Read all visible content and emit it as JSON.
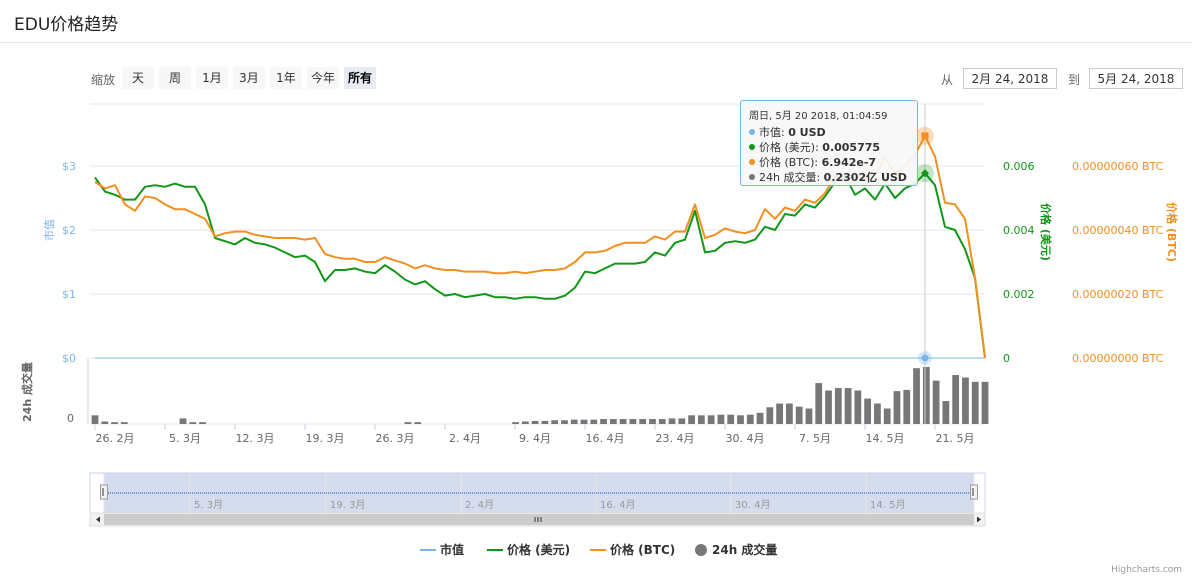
{
  "header": {
    "title": "EDU价格趋势"
  },
  "toolbar": {
    "zoom_label": "缩放",
    "zoom_buttons": [
      "天",
      "周",
      "1月",
      "3月",
      "1年",
      "今年",
      "所有"
    ],
    "from_label": "从",
    "to_label": "到",
    "from_date": "2月 24, 2018",
    "to_date": "5月 24, 2018"
  },
  "tooltip": {
    "date": "周日, 5月 20 2018, 01:04:59",
    "rows": [
      {
        "label": "市值: ",
        "value": "0 USD",
        "color": "#7cb5ec"
      },
      {
        "label": "价格 (美元): ",
        "value": "0.005775",
        "color": "#109618"
      },
      {
        "label": "价格 (BTC): ",
        "value": "6.942e-7",
        "color": "#f28f1e"
      },
      {
        "label": "24h 成交量: ",
        "value": "0.2302亿 USD",
        "color": "#777777"
      }
    ]
  },
  "navigator": {
    "labels": [
      "5. 3月",
      "19. 3月",
      "2. 4月",
      "16. 4月",
      "30. 4月",
      "14. 5月"
    ]
  },
  "credit": "Highcharts.com",
  "chart_data": {
    "type": "line",
    "title": "EDU价格趋势",
    "x_tick_labels": [
      "26. 2月",
      "5. 3月",
      "12. 3月",
      "19. 3月",
      "26. 3月",
      "2. 4月",
      "9. 4月",
      "16. 4月",
      "23. 4月",
      "30. 4月",
      "7. 5月",
      "14. 5月",
      "21. 5月"
    ],
    "y_axes": {
      "market_cap": {
        "label": "市值",
        "ticks": [
          "$0",
          "$1",
          "$2",
          "$3"
        ],
        "range": [
          0,
          3
        ],
        "color": "#7cb5ec"
      },
      "price_usd": {
        "label": "价格 (美元)",
        "ticks": [
          "0",
          "0.002",
          "0.004",
          "0.006"
        ],
        "range": [
          0,
          0.006
        ],
        "color": "#109618"
      },
      "price_btc": {
        "label": "价格 (BTC)",
        "ticks": [
          "0.00000000 BTC",
          "0.00000020 BTC",
          "0.00000040 BTC",
          "0.00000060 BTC"
        ],
        "range": [
          0,
          6e-07
        ],
        "color": "#f28f1e"
      },
      "volume": {
        "label": "24h 成交量",
        "ticks": [
          "0"
        ],
        "color": "#777777"
      }
    },
    "legend": [
      "市值",
      "价格 (美元)",
      "价格 (BTC)",
      "24h 成交量"
    ],
    "legend_position": "bottom-center",
    "x_start_day": 0,
    "x_end_day": 89,
    "series": [
      {
        "name": "价格 (美元)",
        "color": "#109618",
        "axis": "price_usd",
        "points": [
          [
            0,
            0.00564
          ],
          [
            1,
            0.0052
          ],
          [
            2,
            0.0051
          ],
          [
            3,
            0.00495
          ],
          [
            4,
            0.00495
          ],
          [
            5,
            0.00535
          ],
          [
            6,
            0.0054
          ],
          [
            7,
            0.00535
          ],
          [
            8,
            0.00545
          ],
          [
            9,
            0.00535
          ],
          [
            10,
            0.00535
          ],
          [
            11,
            0.0048
          ],
          [
            12,
            0.00375
          ],
          [
            13,
            0.00365
          ],
          [
            14,
            0.00355
          ],
          [
            15,
            0.00375
          ],
          [
            16,
            0.0036
          ],
          [
            17,
            0.00355
          ],
          [
            18,
            0.00345
          ],
          [
            19,
            0.0033
          ],
          [
            20,
            0.00315
          ],
          [
            21,
            0.0032
          ],
          [
            22,
            0.003
          ],
          [
            23,
            0.0024
          ],
          [
            24,
            0.00275
          ],
          [
            25,
            0.00275
          ],
          [
            26,
            0.0028
          ],
          [
            27,
            0.0027
          ],
          [
            28,
            0.00265
          ],
          [
            29,
            0.0029
          ],
          [
            30,
            0.0027
          ],
          [
            31,
            0.00245
          ],
          [
            32,
            0.0023
          ],
          [
            33,
            0.0024
          ],
          [
            34,
            0.00215
          ],
          [
            35,
            0.00195
          ],
          [
            36,
            0.002
          ],
          [
            37,
            0.0019
          ],
          [
            38,
            0.00195
          ],
          [
            39,
            0.002
          ],
          [
            40,
            0.0019
          ],
          [
            41,
            0.0019
          ],
          [
            42,
            0.00185
          ],
          [
            43,
            0.0019
          ],
          [
            44,
            0.0019
          ],
          [
            45,
            0.00185
          ],
          [
            46,
            0.00185
          ],
          [
            47,
            0.00195
          ],
          [
            48,
            0.0022
          ],
          [
            49,
            0.0027
          ],
          [
            50,
            0.00265
          ],
          [
            51,
            0.0028
          ],
          [
            52,
            0.00295
          ],
          [
            53,
            0.00295
          ],
          [
            54,
            0.00295
          ],
          [
            55,
            0.003
          ],
          [
            56,
            0.0033
          ],
          [
            57,
            0.0032
          ],
          [
            58,
            0.0036
          ],
          [
            59,
            0.0037
          ],
          [
            60,
            0.0046
          ],
          [
            61,
            0.0033
          ],
          [
            62,
            0.00335
          ],
          [
            63,
            0.0036
          ],
          [
            64,
            0.00365
          ],
          [
            65,
            0.0036
          ],
          [
            66,
            0.0037
          ],
          [
            67,
            0.0041
          ],
          [
            68,
            0.004
          ],
          [
            69,
            0.0045
          ],
          [
            70,
            0.00445
          ],
          [
            71,
            0.0048
          ],
          [
            72,
            0.0047
          ],
          [
            73,
            0.00505
          ],
          [
            74,
            0.0055
          ],
          [
            75,
            0.0057
          ],
          [
            76,
            0.0051
          ],
          [
            77,
            0.0053
          ],
          [
            78,
            0.00495
          ],
          [
            79,
            0.00545
          ],
          [
            80,
            0.005
          ],
          [
            81,
            0.0053
          ],
          [
            82,
            0.00545
          ],
          [
            83,
            0.005775
          ],
          [
            84,
            0.0054
          ],
          [
            85,
            0.0041
          ],
          [
            86,
            0.004
          ],
          [
            87,
            0.0034
          ],
          [
            88,
            0.0025
          ],
          [
            89,
            0
          ]
        ]
      },
      {
        "name": "价格 (BTC)",
        "color": "#f28f1e",
        "axis": "price_btc",
        "points": [
          [
            0,
            5.5e-07
          ],
          [
            1,
            5.3e-07
          ],
          [
            2,
            5.4e-07
          ],
          [
            3,
            4.8e-07
          ],
          [
            4,
            4.6e-07
          ],
          [
            5,
            5.05e-07
          ],
          [
            6,
            5e-07
          ],
          [
            7,
            4.8e-07
          ],
          [
            8,
            4.65e-07
          ],
          [
            9,
            4.65e-07
          ],
          [
            10,
            4.5e-07
          ],
          [
            11,
            4.35e-07
          ],
          [
            12,
            3.8e-07
          ],
          [
            13,
            3.9e-07
          ],
          [
            14,
            3.95e-07
          ],
          [
            15,
            3.95e-07
          ],
          [
            16,
            3.85e-07
          ],
          [
            17,
            3.8e-07
          ],
          [
            18,
            3.75e-07
          ],
          [
            19,
            3.75e-07
          ],
          [
            20,
            3.75e-07
          ],
          [
            21,
            3.7e-07
          ],
          [
            22,
            3.75e-07
          ],
          [
            23,
            3.25e-07
          ],
          [
            24,
            3.15e-07
          ],
          [
            25,
            3.1e-07
          ],
          [
            26,
            3.1e-07
          ],
          [
            27,
            3e-07
          ],
          [
            28,
            3e-07
          ],
          [
            29,
            3.15e-07
          ],
          [
            30,
            3.05e-07
          ],
          [
            31,
            2.95e-07
          ],
          [
            32,
            2.8e-07
          ],
          [
            33,
            2.9e-07
          ],
          [
            34,
            2.8e-07
          ],
          [
            35,
            2.75e-07
          ],
          [
            36,
            2.75e-07
          ],
          [
            37,
            2.7e-07
          ],
          [
            38,
            2.7e-07
          ],
          [
            39,
            2.7e-07
          ],
          [
            40,
            2.65e-07
          ],
          [
            41,
            2.65e-07
          ],
          [
            42,
            2.7e-07
          ],
          [
            43,
            2.65e-07
          ],
          [
            44,
            2.7e-07
          ],
          [
            45,
            2.75e-07
          ],
          [
            46,
            2.75e-07
          ],
          [
            47,
            2.8e-07
          ],
          [
            48,
            3e-07
          ],
          [
            49,
            3.3e-07
          ],
          [
            50,
            3.3e-07
          ],
          [
            51,
            3.35e-07
          ],
          [
            52,
            3.5e-07
          ],
          [
            53,
            3.6e-07
          ],
          [
            54,
            3.6e-07
          ],
          [
            55,
            3.6e-07
          ],
          [
            56,
            3.8e-07
          ],
          [
            57,
            3.7e-07
          ],
          [
            58,
            3.95e-07
          ],
          [
            59,
            3.95e-07
          ],
          [
            60,
            4.8e-07
          ],
          [
            61,
            3.75e-07
          ],
          [
            62,
            3.85e-07
          ],
          [
            63,
            4.05e-07
          ],
          [
            64,
            3.95e-07
          ],
          [
            65,
            3.9e-07
          ],
          [
            66,
            4e-07
          ],
          [
            67,
            4.65e-07
          ],
          [
            68,
            4.35e-07
          ],
          [
            69,
            4.7e-07
          ],
          [
            70,
            4.6e-07
          ],
          [
            71,
            4.95e-07
          ],
          [
            72,
            4.85e-07
          ],
          [
            73,
            5.15e-07
          ],
          [
            74,
            5.7e-07
          ],
          [
            75,
            5.5e-07
          ],
          [
            76,
            5.45e-07
          ],
          [
            77,
            5.7e-07
          ],
          [
            78,
            5.7e-07
          ],
          [
            79,
            6.25e-07
          ],
          [
            80,
            5.75e-07
          ],
          [
            81,
            6e-07
          ],
          [
            82,
            6.35e-07
          ],
          [
            83,
            6.942e-07
          ],
          [
            84,
            6.3e-07
          ],
          [
            85,
            4.85e-07
          ],
          [
            86,
            4.8e-07
          ],
          [
            87,
            4.35e-07
          ],
          [
            88,
            2.5e-07
          ],
          [
            89,
            0
          ]
        ]
      },
      {
        "name": "市值",
        "color": "#7cb5ec",
        "axis": "market_cap",
        "points": [
          [
            0,
            0
          ],
          [
            89,
            0
          ]
        ]
      },
      {
        "name": "24h 成交量",
        "color": "#777777",
        "axis": "volume",
        "type": "column",
        "points": [
          [
            0,
            0.14
          ],
          [
            1,
            0.04
          ],
          [
            2,
            0.03
          ],
          [
            3,
            0.03
          ],
          [
            9,
            0.09
          ],
          [
            10,
            0.03
          ],
          [
            11,
            0.03
          ],
          [
            32,
            0.03
          ],
          [
            33,
            0.03
          ],
          [
            43,
            0.03
          ],
          [
            44,
            0.04
          ],
          [
            45,
            0.05
          ],
          [
            46,
            0.05
          ],
          [
            47,
            0.06
          ],
          [
            48,
            0.06
          ],
          [
            49,
            0.07
          ],
          [
            50,
            0.07
          ],
          [
            51,
            0.07
          ],
          [
            52,
            0.08
          ],
          [
            53,
            0.08
          ],
          [
            54,
            0.08
          ],
          [
            55,
            0.08
          ],
          [
            56,
            0.08
          ],
          [
            57,
            0.08
          ],
          [
            58,
            0.08
          ],
          [
            59,
            0.09
          ],
          [
            60,
            0.09
          ],
          [
            61,
            0.14
          ],
          [
            62,
            0.14
          ],
          [
            63,
            0.14
          ],
          [
            64,
            0.15
          ],
          [
            65,
            0.15
          ],
          [
            66,
            0.14
          ],
          [
            67,
            0.15
          ],
          [
            68,
            0.18
          ],
          [
            69,
            0.27
          ],
          [
            70,
            0.33
          ],
          [
            71,
            0.33
          ],
          [
            72,
            0.28
          ],
          [
            73,
            0.25
          ],
          [
            74,
            0.66
          ],
          [
            75,
            0.54
          ],
          [
            76,
            0.58
          ],
          [
            77,
            0.58
          ],
          [
            78,
            0.54
          ],
          [
            79,
            0.41
          ],
          [
            80,
            0.33
          ],
          [
            81,
            0.25
          ],
          [
            82,
            0.53
          ],
          [
            83,
            0.55
          ],
          [
            84,
            0.9
          ],
          [
            85,
            0.92
          ],
          [
            86,
            0.7
          ],
          [
            87,
            0.37
          ],
          [
            88,
            0.79
          ],
          [
            89,
            0.75
          ],
          [
            90,
            0.68
          ],
          [
            91,
            0.68
          ]
        ]
      }
    ]
  }
}
